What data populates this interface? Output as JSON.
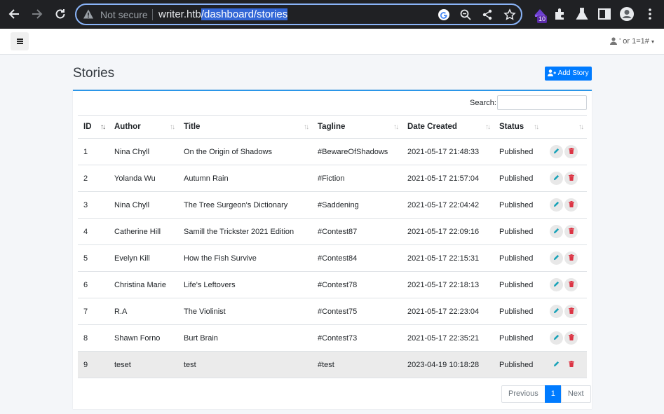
{
  "browser": {
    "not_secure": "Not secure",
    "url_host": "writer.htb",
    "url_path": "/dashboard/stories",
    "extension_badge": "10"
  },
  "navbar": {
    "user_label": "' or 1=1#"
  },
  "page": {
    "title": "Stories",
    "add_button": "Add Story"
  },
  "table": {
    "search_label": "Search:",
    "search_value": "",
    "columns": [
      "ID",
      "Author",
      "Title",
      "Tagline",
      "Date Created",
      "Status",
      ""
    ],
    "rows": [
      {
        "id": "1",
        "author": "Nina Chyll",
        "title": "On the Origin of Shadows",
        "tagline": "#BewareOfShadows",
        "date": "2021-05-17 21:48:33",
        "status": "Published"
      },
      {
        "id": "2",
        "author": "Yolanda Wu",
        "title": "Autumn Rain",
        "tagline": "#Fiction",
        "date": "2021-05-17 21:57:04",
        "status": "Published"
      },
      {
        "id": "3",
        "author": "Nina Chyll",
        "title": "The Tree Surgeon's Dictionary",
        "tagline": "#Saddening",
        "date": "2021-05-17 22:04:42",
        "status": "Published"
      },
      {
        "id": "4",
        "author": "Catherine Hill",
        "title": "Samill the Trickster 2021 Edition",
        "tagline": "#Contest87",
        "date": "2021-05-17 22:09:16",
        "status": "Published"
      },
      {
        "id": "5",
        "author": "Evelyn Kill",
        "title": "How the Fish Survive",
        "tagline": "#Contest84",
        "date": "2021-05-17 22:15:31",
        "status": "Published"
      },
      {
        "id": "6",
        "author": "Christina Marie",
        "title": "Life's Leftovers",
        "tagline": "#Contest78",
        "date": "2021-05-17 22:18:13",
        "status": "Published"
      },
      {
        "id": "7",
        "author": "R.A",
        "title": "The Violinist",
        "tagline": "#Contest75",
        "date": "2021-05-17 22:23:04",
        "status": "Published"
      },
      {
        "id": "8",
        "author": "Shawn Forno",
        "title": "Burt Brain",
        "tagline": "#Contest73",
        "date": "2021-05-17 22:35:21",
        "status": "Published"
      },
      {
        "id": "9",
        "author": "teset",
        "title": "test",
        "tagline": "#test",
        "date": "2023-04-19 10:18:28",
        "status": "Published"
      }
    ]
  },
  "pagination": {
    "previous": "Previous",
    "current": "1",
    "next": "Next"
  },
  "colors": {
    "primary": "#007bff",
    "accent_border": "#2b96e8",
    "edit_icon": "#17a2b8",
    "delete_icon": "#dc3545"
  }
}
